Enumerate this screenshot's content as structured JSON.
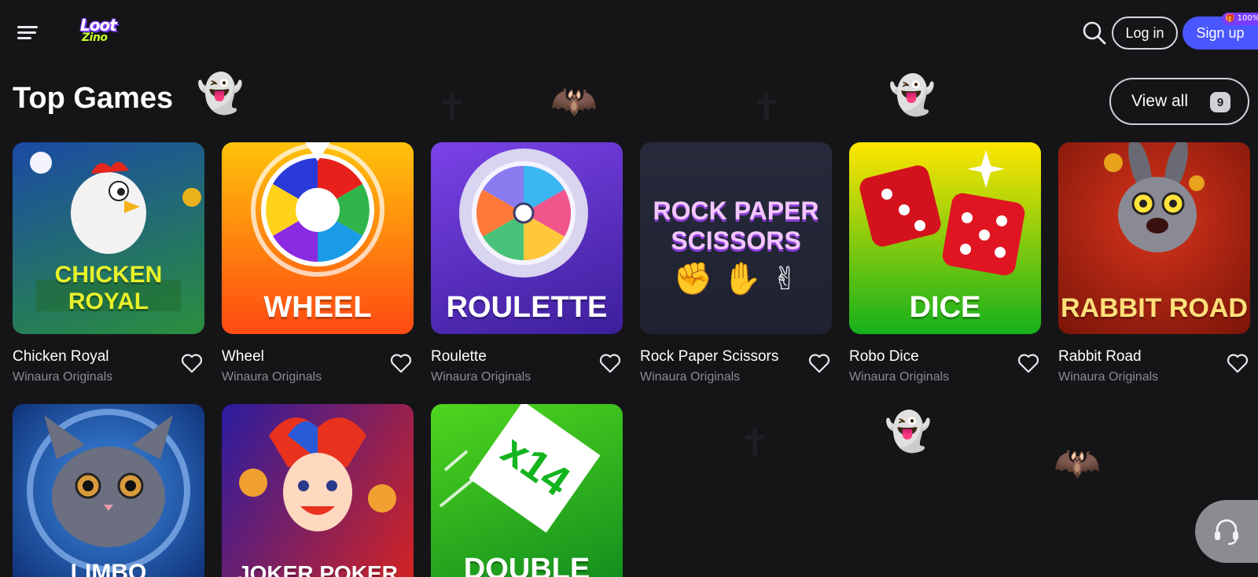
{
  "header": {
    "logo_top": "Loot",
    "logo_bottom": "Zino",
    "login_label": "Log in",
    "signup_label": "Sign up",
    "bonus_badge": "🎁 100%"
  },
  "section": {
    "title": "Top Games",
    "view_all_label": "View all",
    "view_all_count": "9"
  },
  "games": [
    {
      "title": "Chicken Royal",
      "provider": "Winaura Originals",
      "art_text": "CHICKEN ROYAL",
      "colors": [
        "#2a8f3c",
        "#1b4aa6"
      ]
    },
    {
      "title": "Wheel",
      "provider": "Winaura Originals",
      "art_text": "WHEEL",
      "colors": [
        "#ff4a12",
        "#ffc20a"
      ]
    },
    {
      "title": "Roulette",
      "provider": "Winaura Originals",
      "art_text": "ROULETTE",
      "colors": [
        "#3c1f9a",
        "#7b42e8"
      ]
    },
    {
      "title": "Rock Paper Scissors",
      "provider": "Winaura Originals",
      "art_text": "ROCK PAPER SCISSORS",
      "colors": [
        "#1f2230",
        "#262a3a"
      ]
    },
    {
      "title": "Robo Dice",
      "provider": "Winaura Originals",
      "art_text": "DICE",
      "colors": [
        "#15b01c",
        "#ffe600"
      ]
    },
    {
      "title": "Rabbit Road",
      "provider": "Winaura Originals",
      "art_text": "RABBIT ROAD",
      "colors": [
        "#7a1508",
        "#d8341c"
      ]
    },
    {
      "title": "Limbo",
      "provider": "",
      "art_text": "LIMBO",
      "colors": [
        "#0b2a6e",
        "#3f8ee8"
      ]
    },
    {
      "title": "Joker Poker",
      "provider": "",
      "art_text": "JOKER POKER",
      "colors": [
        "#2a1ca0",
        "#d8241e"
      ]
    },
    {
      "title": "Double",
      "provider": "",
      "art_text": "DOUBLE",
      "colors": [
        "#0f8a1e",
        "#4fd61e"
      ]
    }
  ],
  "icons": {
    "menu": "menu-icon",
    "search": "search-icon",
    "heart": "heart-icon",
    "support": "headset-icon"
  },
  "colors": {
    "background": "#151518",
    "accent": "#4a56ff",
    "muted_text": "#8a8a92"
  }
}
